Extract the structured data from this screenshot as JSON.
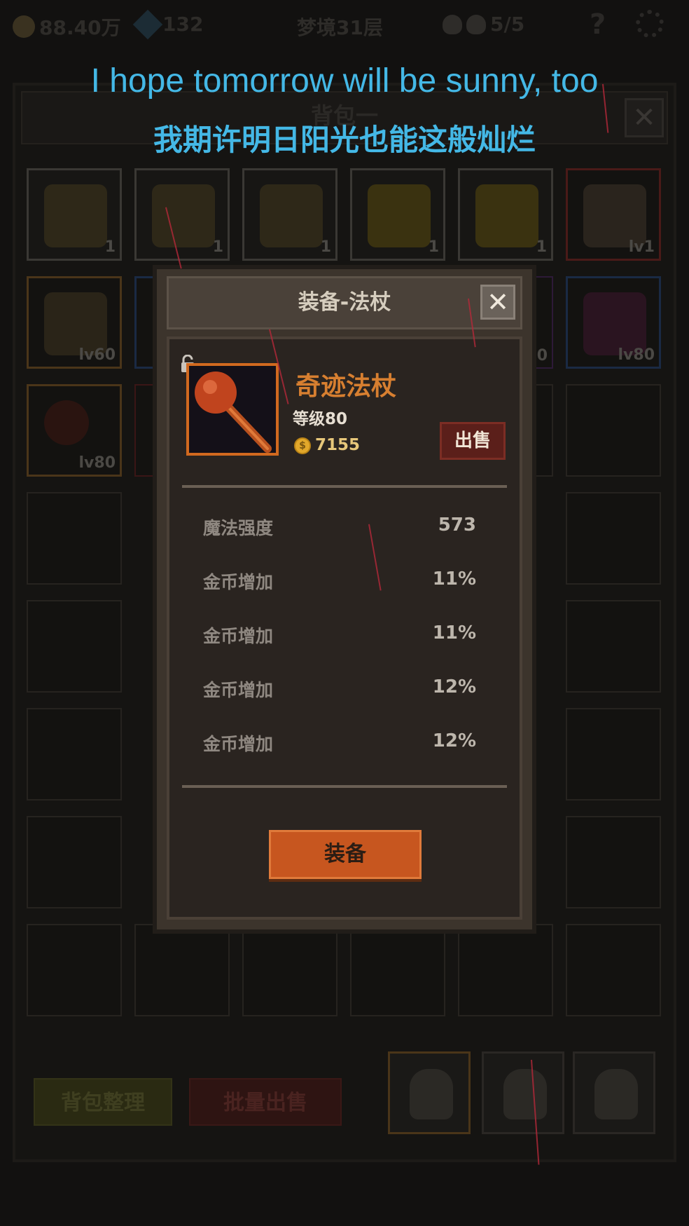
{
  "top_bar": {
    "gold": "88.40万",
    "gems": "132",
    "dungeon": "梦境31层",
    "skull_count": "5/5"
  },
  "subtitles": {
    "english": "I hope tomorrow will be sunny, too",
    "chinese": "我期许明日阳光也能这般灿烂"
  },
  "bag": {
    "title": "背包一",
    "row1": [
      {
        "item": "beer-mug",
        "qty": "1"
      },
      {
        "item": "beer-mug",
        "qty": "1"
      },
      {
        "item": "beer-mug",
        "qty": "1"
      },
      {
        "item": "cheese",
        "qty": "1"
      },
      {
        "item": "cheese",
        "qty": "1"
      },
      {
        "item": "shield",
        "qty": "lv1"
      }
    ],
    "row2_first": "lv60",
    "row2_partial": "0",
    "row2_last": "lv80",
    "row3_first": "lv80",
    "sort_button": "背包整理",
    "batch_sell_button": "批量出售"
  },
  "modal": {
    "title": "装备-法杖",
    "item_name": "奇迹法杖",
    "level": "等级80",
    "price": "7155",
    "sell_button": "出售",
    "stats": [
      {
        "label": "魔法强度",
        "value": "573"
      },
      {
        "label": "金币增加",
        "value": "11%"
      },
      {
        "label": "金币增加",
        "value": "11%"
      },
      {
        "label": "金币增加",
        "value": "12%"
      },
      {
        "label": "金币增加",
        "value": "12%"
      }
    ],
    "equip_button": "装备"
  },
  "colors": {
    "subtitle": "#44b8e6",
    "item_name": "#d77f30",
    "equip_button": "#c7561f",
    "sell_button": "#5b1f1a"
  }
}
